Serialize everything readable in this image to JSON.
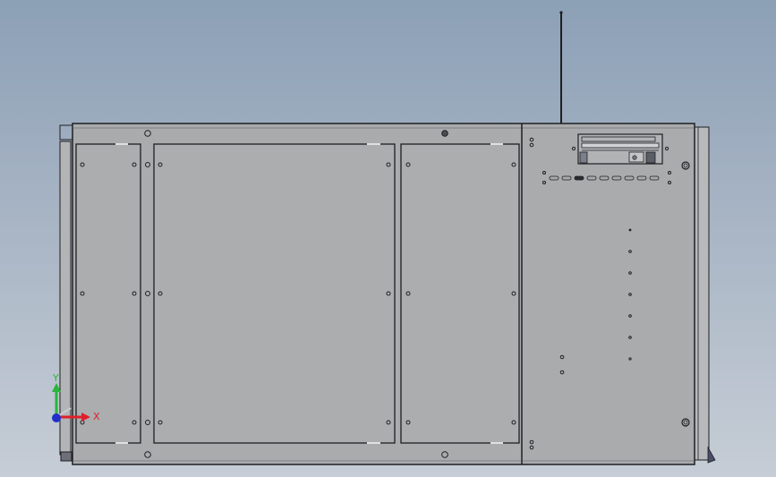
{
  "app": {
    "type": "cad-viewport",
    "view": "front"
  },
  "model": {
    "name": "",
    "description": ""
  },
  "triad": {
    "x_label": "X",
    "y_label": "Y",
    "x_color": "#e0202a",
    "y_color": "#2ab53a",
    "z_color": "#2030c8"
  },
  "colors": {
    "background_top": "#8ca0b6",
    "background_bottom": "#c6cdd6",
    "body_fill": "#a9abad",
    "panel_fill": "#abadaf",
    "edge": "#1e1f22"
  }
}
